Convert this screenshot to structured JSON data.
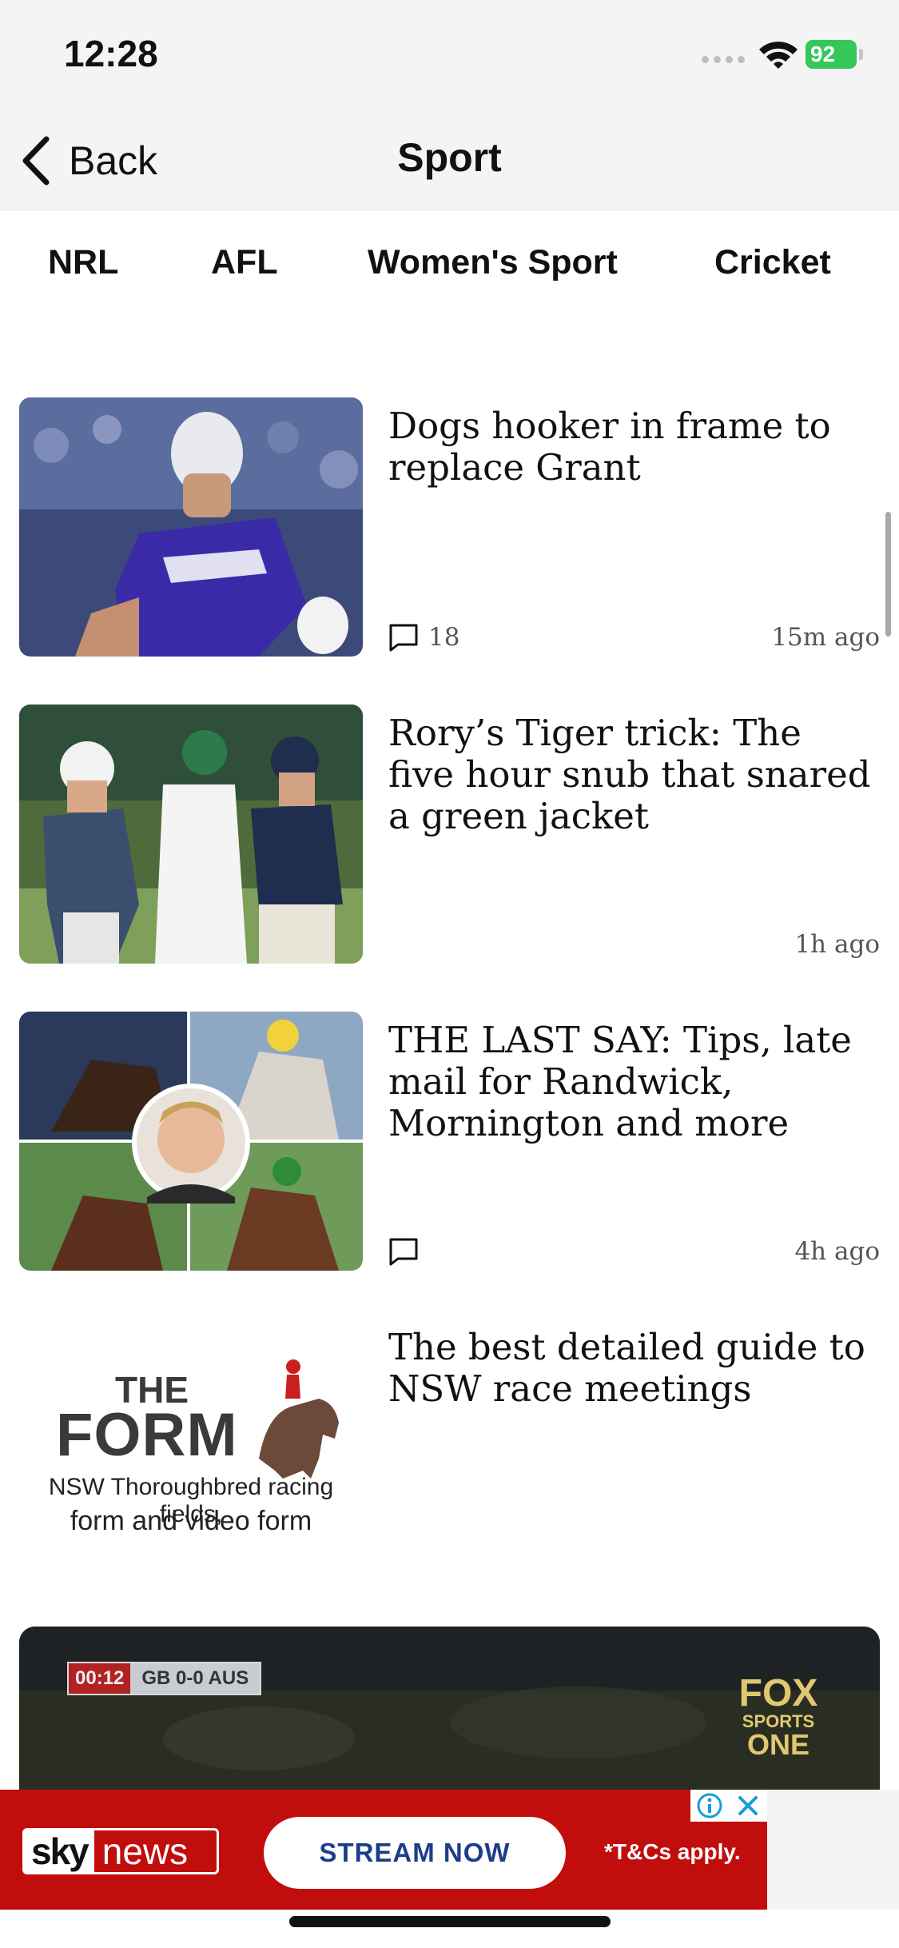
{
  "status": {
    "time": "12:28",
    "battery": "92"
  },
  "nav": {
    "back_label": "Back",
    "title": "Sport"
  },
  "tabs": [
    "NRL",
    "AFL",
    "Women's Sport",
    "Cricket"
  ],
  "articles": [
    {
      "headline": "Dogs hooker in frame to replace Grant",
      "comments": "18",
      "time_ago": "15m  ago"
    },
    {
      "headline": "Rory’s Tiger trick: The five hour snub that snared a green jacket",
      "comments": "",
      "time_ago": "1h  ago"
    },
    {
      "headline": "THE LAST SAY: Tips, late mail for Randwick, Mornington and more",
      "comments": "",
      "time_ago": "4h  ago"
    },
    {
      "headline": "The best detailed guide to NSW race meetings",
      "comments": "",
      "time_ago": ""
    }
  ],
  "form_promo": {
    "title_line1": "THE",
    "title_line2": "FORM",
    "subtitle_line1": "NSW Thoroughbred racing fields,",
    "subtitle_line2": "form and video form"
  },
  "video": {
    "score_time": "00:12",
    "score_text": "GB 0-0 AUS",
    "channel_line1": "FOX",
    "channel_line2": "SPORTS",
    "channel_line3": "ONE"
  },
  "ad": {
    "brand_sky": "sky",
    "brand_news": "news",
    "cta": "STREAM NOW",
    "terms": "*T&Cs apply."
  },
  "colors": {
    "ad_red": "#c20d0d",
    "battery_green": "#34c759",
    "cta_blue": "#1c3d8a"
  }
}
